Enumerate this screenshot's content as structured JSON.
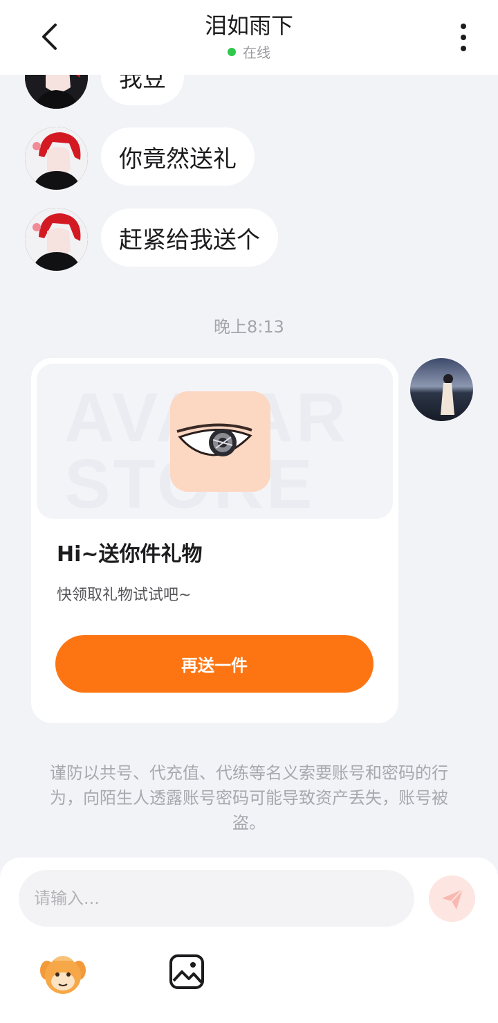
{
  "header": {
    "title": "泪如雨下",
    "status": "在线"
  },
  "messages": [
    {
      "text": "我豆"
    },
    {
      "text": "你竟然送礼"
    },
    {
      "text": "赶紧给我送个"
    }
  ],
  "timestamp": "晚上8:13",
  "gift_card": {
    "banner_text": "AVATAR STORE",
    "title": "Hi~送你件礼物",
    "subtitle": "快领取礼物试试吧~",
    "button_label": "再送一件"
  },
  "warning": "谨防以共号、代充值、代练等名义索要账号和密码的行为，向陌生人透露账号密码可能导致资产丢失，账号被盗。",
  "composer": {
    "placeholder": "请输入..."
  },
  "colors": {
    "accent": "#fd7512",
    "online": "#2fc84b",
    "background": "#f2f3f7"
  },
  "icons": [
    "back-icon",
    "more-vertical-icon",
    "send-icon",
    "mascot-sticker-icon",
    "image-icon"
  ]
}
